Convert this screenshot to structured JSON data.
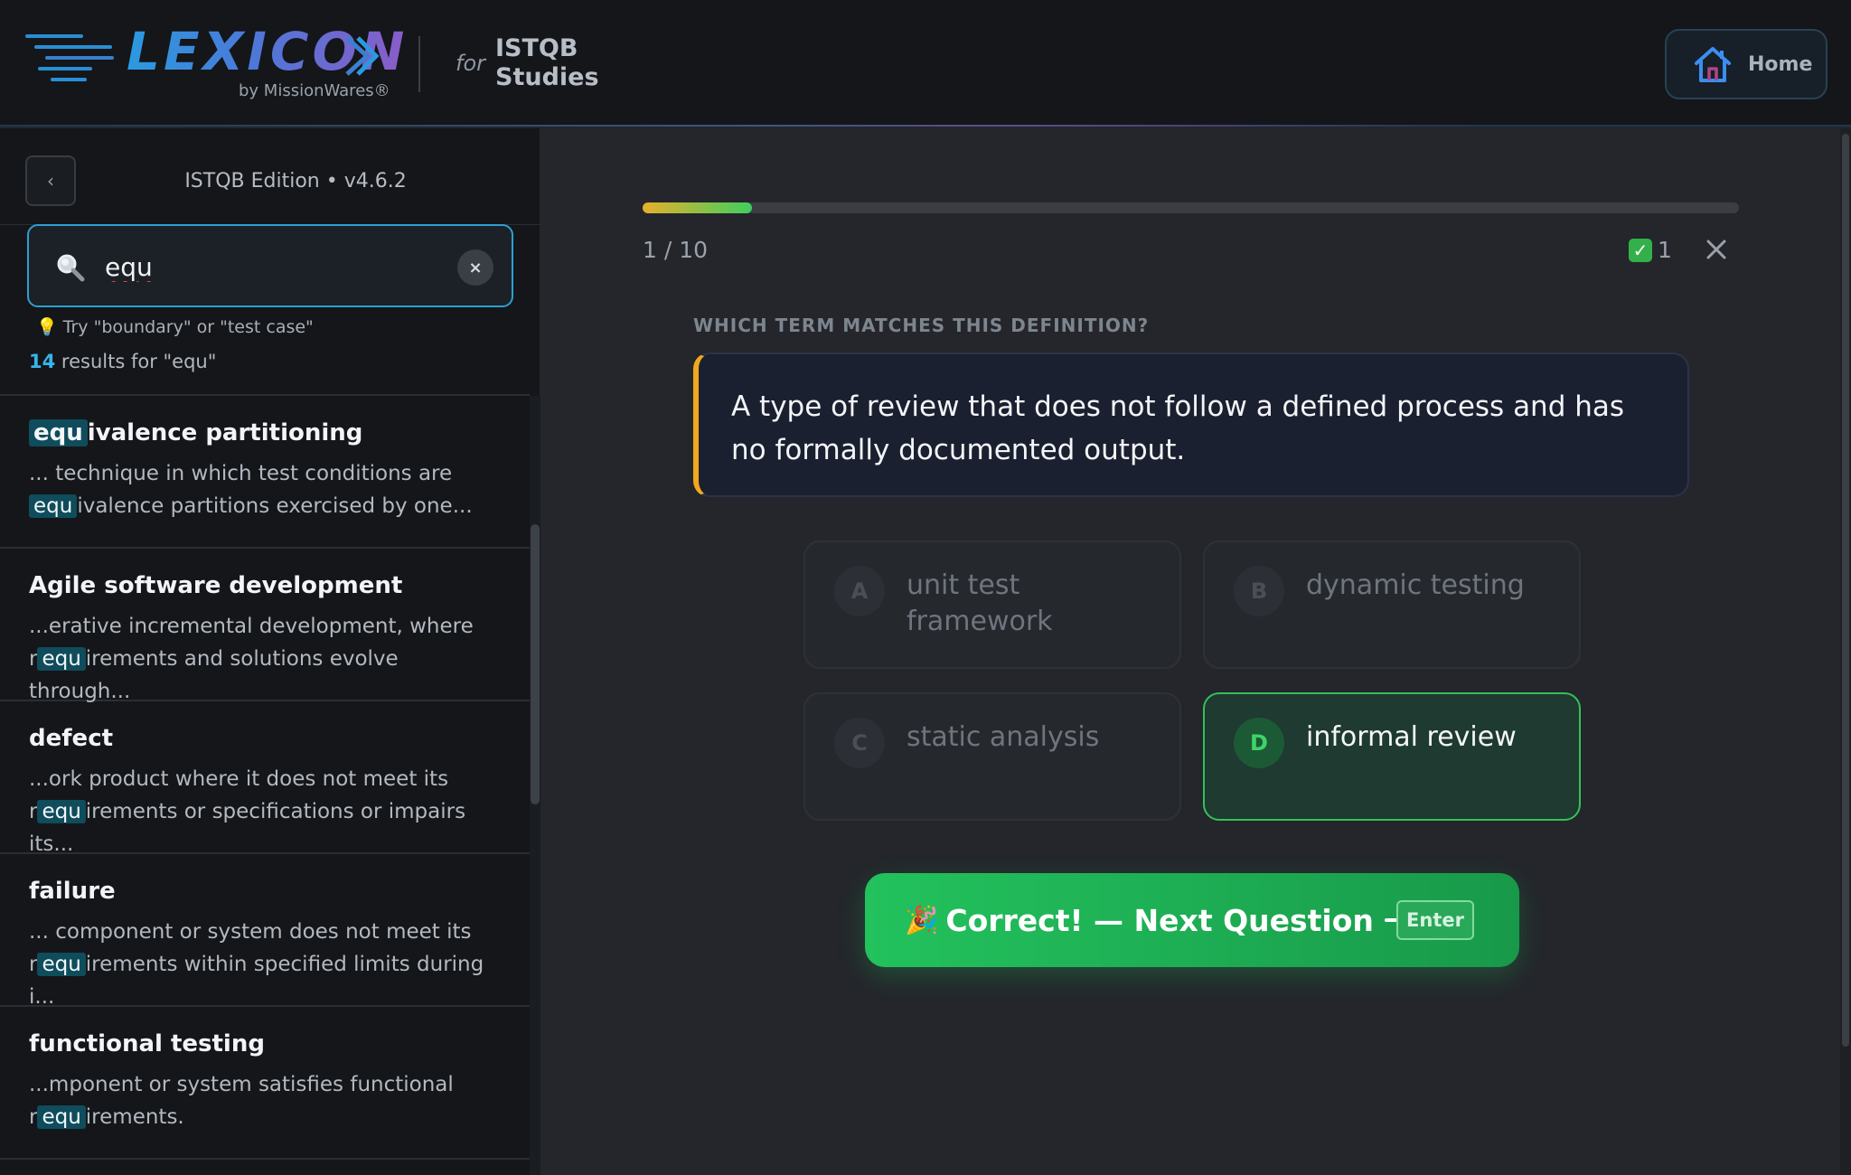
{
  "header": {
    "logo_text": "LEXICON",
    "logo_byline": "by MissionWares®",
    "for_label": "for",
    "product_line1": "ISTQB",
    "product_line2": "Studies",
    "home_label": "Home"
  },
  "sidebar": {
    "collapse_glyph": "‹",
    "edition": "ISTQB Edition • v4.6.2",
    "search": {
      "value": "equ",
      "clear_glyph": "×"
    },
    "hint": "Try \"boundary\" or \"test case\"",
    "results": {
      "count": "14",
      "suffix": "results for \"equ\""
    },
    "items": [
      {
        "title_hl": "equ",
        "title_rest": "ivalence partitioning",
        "line1": "... technique in which test conditions are",
        "line2_pre": "",
        "line2_hl": "equ",
        "line2_post": "ivalence partitions exercised by one..."
      },
      {
        "title": "Agile software development",
        "line1": "...erative incremental development, where",
        "line2_pre": "r",
        "line2_hl": "equ",
        "line2_post": "irements and solutions evolve through..."
      },
      {
        "title": "defect",
        "line1": "...ork product where it does not meet its",
        "line2_pre": "r",
        "line2_hl": "equ",
        "line2_post": "irements or specifications or impairs its..."
      },
      {
        "title": "failure",
        "line1": "... component or system does not meet its",
        "line2_pre": "r",
        "line2_hl": "equ",
        "line2_post": "irements within specified limits during i..."
      },
      {
        "title": "functional testing",
        "line1": "...mponent or system satisfies functional",
        "line2_pre": "r",
        "line2_hl": "equ",
        "line2_post": "irements."
      }
    ]
  },
  "quiz": {
    "progress": 0.1,
    "counter": "1 / 10",
    "score": "1",
    "question_label": "WHICH TERM MATCHES THIS DEFINITION?",
    "definition": "A type of review that does not follow a defined process and has no formally documented output.",
    "options": [
      {
        "letter": "A",
        "text": "unit test framework"
      },
      {
        "letter": "B",
        "text": "dynamic testing"
      },
      {
        "letter": "C",
        "text": "static analysis"
      },
      {
        "letter": "D",
        "text": "informal review"
      }
    ],
    "correct_option": "D",
    "next_button": {
      "emoji": "🎉",
      "label": "Correct! —  Next Question",
      "key_hint": "Enter"
    }
  },
  "colors": {
    "accent_blue": "#2e9fd0",
    "correct_green": "#32c15a",
    "definition_accent": "#f0a81e",
    "highlight_bg": "#0f4c5c"
  }
}
